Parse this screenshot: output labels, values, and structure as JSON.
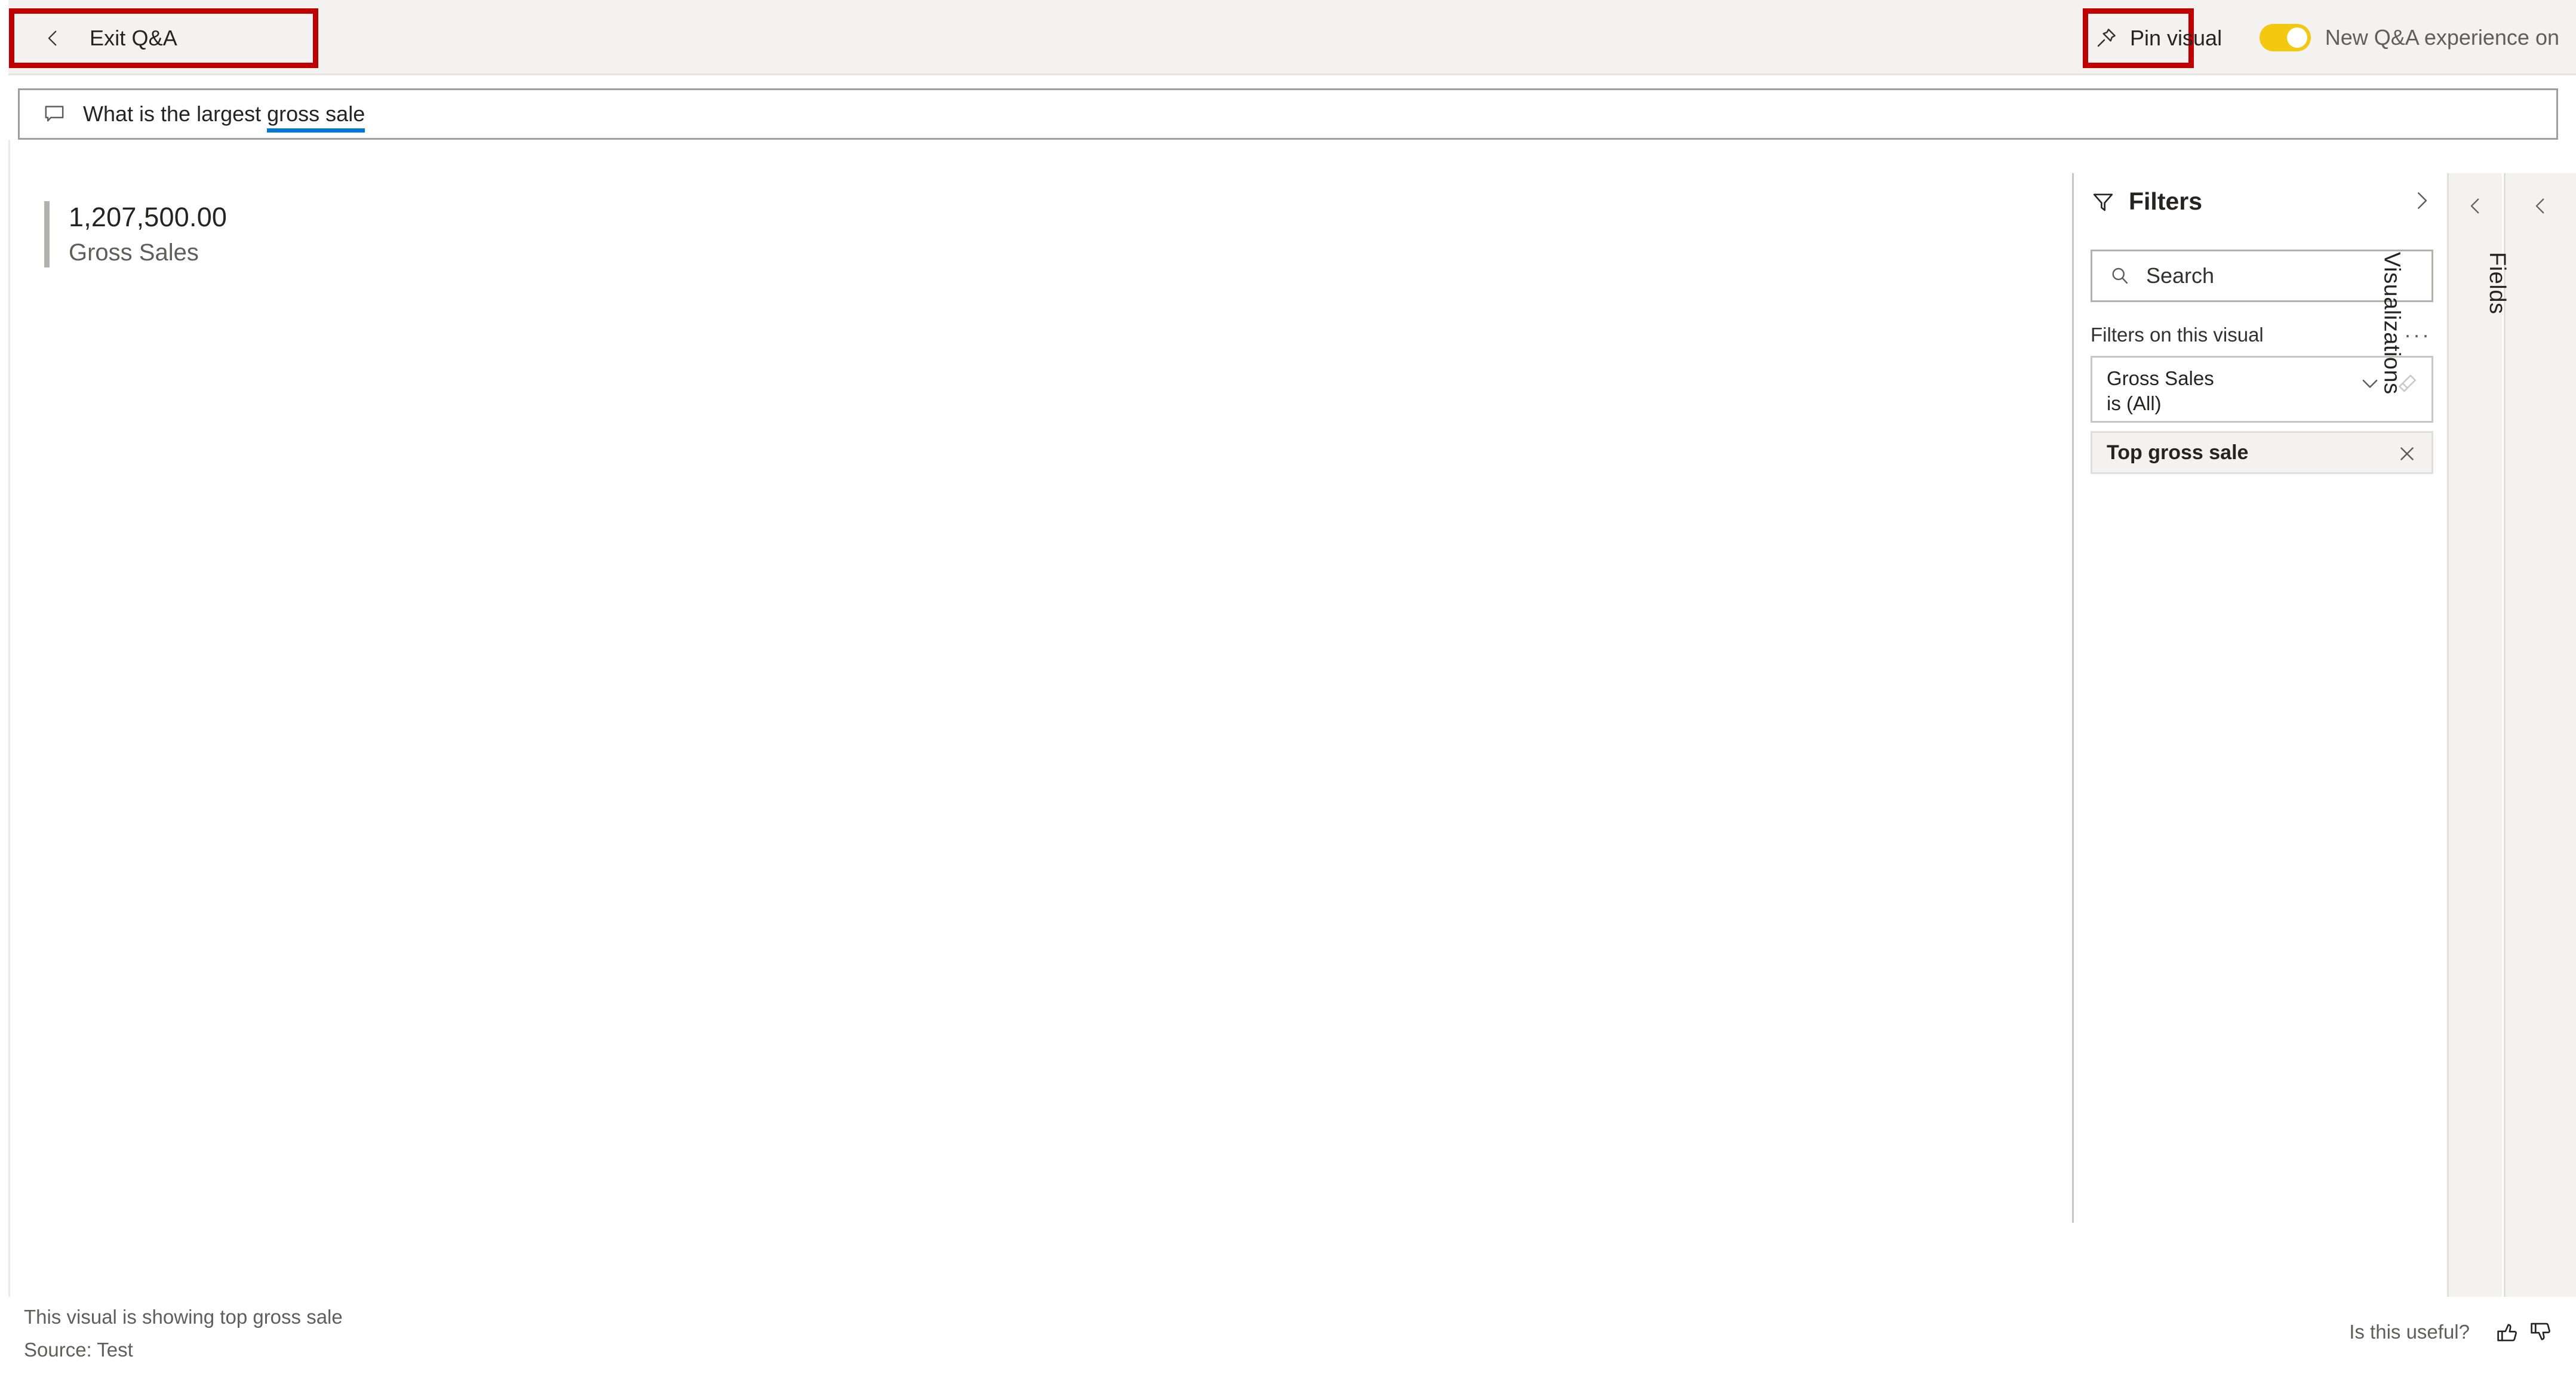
{
  "toolbar": {
    "exit_label": "Exit Q&A",
    "exit_icon": "chevron-left-icon",
    "pin_label": "Pin visual",
    "pin_icon": "pin-icon",
    "toggle_label": "New Q&A experience on",
    "toggle_state": "on",
    "toggle_color": "#f2c811",
    "highlight_color": "#c00000"
  },
  "question_bar": {
    "icon": "speech-bubble-icon",
    "text_prefix": "What is the largest ",
    "text_keyword": "gross sale",
    "keyword_underline_color": "#0078d4"
  },
  "visual": {
    "value": "1,207,500.00",
    "label": "Gross Sales",
    "accent_color": "#b3b0ad"
  },
  "filters_pane": {
    "title": "Filters",
    "title_icon": "funnel-icon",
    "collapse_icon": "chevron-right-icon",
    "search": {
      "icon": "search-icon",
      "placeholder": "Search",
      "value": ""
    },
    "section_title": "Filters on this visual",
    "more_menu": "···",
    "cards": [
      {
        "field": "Gross Sales",
        "condition": "is (All)",
        "expand_icon": "chevron-down-icon",
        "clear_icon": "eraser-icon"
      }
    ],
    "chip": {
      "label": "Top gross sale",
      "close_icon": "close-icon"
    }
  },
  "side_panels": [
    {
      "label": "Visualizations",
      "collapse_icon": "chevron-left-icon"
    },
    {
      "label": "Fields",
      "collapse_icon": "chevron-left-icon"
    }
  ],
  "footer": {
    "line1": "This visual is showing top gross sale",
    "line2": "Source: Test",
    "useful_label": "Is this useful?",
    "thumbs_up_icon": "thumbs-up-icon",
    "thumbs_down_icon": "thumbs-down-icon"
  }
}
